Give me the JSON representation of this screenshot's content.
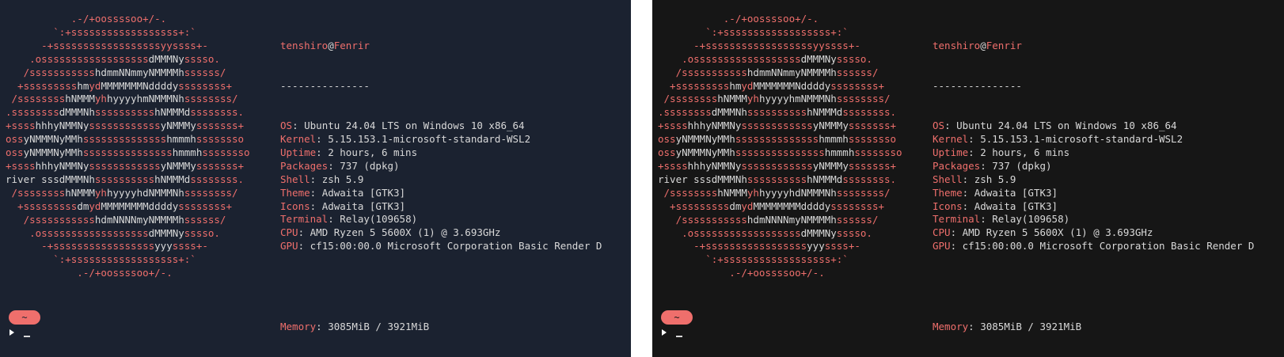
{
  "colors": {
    "left_bg": "#1b2230",
    "right_bg": "#161616",
    "accent": "#ef6f6c",
    "text": "#d9d9d9"
  },
  "ascii_logo": [
    [
      [
        "           .-/+oossssoo+/-.",
        "r"
      ]
    ],
    [
      [
        "        `:+ssssssssssssssssss+:`",
        "r"
      ]
    ],
    [
      [
        "      -+ssssssssssssssssssyyssss+-",
        "r"
      ]
    ],
    [
      [
        "    .ossssssssssssssssss",
        "r"
      ],
      [
        "dMMMNy",
        "w"
      ],
      [
        "sssso.",
        "r"
      ]
    ],
    [
      [
        "   /sssssssssss",
        "r"
      ],
      [
        "hdmmNNmmyNMMMMh",
        "w"
      ],
      [
        "ssssss/",
        "r"
      ]
    ],
    [
      [
        "  +sssssssss",
        "r"
      ],
      [
        "hm",
        "w"
      ],
      [
        "yd",
        "r"
      ],
      [
        "MMMMMMMNddddy",
        "w"
      ],
      [
        "ssssssss+",
        "r"
      ]
    ],
    [
      [
        " /ssssssss",
        "r"
      ],
      [
        "hNMMM",
        "w"
      ],
      [
        "yh",
        "r"
      ],
      [
        "hyyyyhmNMMMNh",
        "w"
      ],
      [
        "ssssssss/",
        "r"
      ]
    ],
    [
      [
        ".ssssssss",
        "r"
      ],
      [
        "dMMMNh",
        "w"
      ],
      [
        "ssssssssss",
        "r"
      ],
      [
        "hNMMMd",
        "w"
      ],
      [
        "ssssssss.",
        "r"
      ]
    ],
    [
      [
        "+ssss",
        "r"
      ],
      [
        "hhhyNMMNy",
        "w"
      ],
      [
        "ssssssssssss",
        "r"
      ],
      [
        "yNMMMy",
        "w"
      ],
      [
        "sssssss+",
        "r"
      ]
    ],
    [
      [
        "oss",
        "r"
      ],
      [
        "yNMMMNyMMh",
        "w"
      ],
      [
        "ssssssssssssss",
        "r"
      ],
      [
        "hmmmh",
        "w"
      ],
      [
        "ssssssso",
        "r"
      ]
    ],
    [
      [
        "oss",
        "r"
      ],
      [
        "yNMMMNyMMh",
        "w"
      ],
      [
        "sssssssssssssss",
        "r"
      ],
      [
        "hmmmh",
        "w"
      ],
      [
        "ssssssso",
        "r"
      ]
    ],
    [
      [
        "+ssss",
        "r"
      ],
      [
        "hhhyNMMNy",
        "w"
      ],
      [
        "ssssssssssss",
        "r"
      ],
      [
        "yNMMMy",
        "w"
      ],
      [
        "sssssss+",
        "r"
      ]
    ],
    [
      [
        "river sss",
        "w"
      ],
      [
        "dMMMNh",
        "w"
      ],
      [
        "ssssssssss",
        "r"
      ],
      [
        "hNMMMd",
        "w"
      ],
      [
        "ssssssss.",
        "r"
      ]
    ],
    [
      [
        " /ssssssss",
        "r"
      ],
      [
        "hNMMM",
        "w"
      ],
      [
        "yh",
        "r"
      ],
      [
        "hyyyyhdNMMMNh",
        "w"
      ],
      [
        "ssssssss/",
        "r"
      ]
    ],
    [
      [
        "  +sssssssss",
        "r"
      ],
      [
        "dm",
        "w"
      ],
      [
        "yd",
        "r"
      ],
      [
        "MMMMMMMMddddy",
        "w"
      ],
      [
        "ssssssss+",
        "r"
      ]
    ],
    [
      [
        "   /sssssssssss",
        "r"
      ],
      [
        "hdmNNNNmyNMMMMh",
        "w"
      ],
      [
        "ssssss/",
        "r"
      ]
    ],
    [
      [
        "    .ossssssssssssssssss",
        "r"
      ],
      [
        "dMMMNy",
        "w"
      ],
      [
        "sssso.",
        "r"
      ]
    ],
    [
      [
        "      -+sssssssssssssssss",
        "r"
      ],
      [
        "yyy",
        "w"
      ],
      [
        "ssss+-",
        "r"
      ]
    ],
    [
      [
        "        `:+ssssssssssssssssss+:`",
        "r"
      ]
    ],
    [
      [
        "            .-/+oossssoo+/-.",
        "r"
      ]
    ]
  ],
  "info": {
    "user": "tenshiro",
    "at": "@",
    "host": "Fenrir",
    "separator": "---------------",
    "rows": [
      {
        "key": "OS",
        "value": "Ubuntu 24.04 LTS on Windows 10 x86_64"
      },
      {
        "key": "Kernel",
        "value": "5.15.153.1-microsoft-standard-WSL2"
      },
      {
        "key": "Uptime",
        "value": "2 hours, 6 mins"
      },
      {
        "key": "Packages",
        "value": "737 (dpkg)"
      },
      {
        "key": "Shell",
        "value": "zsh 5.9"
      },
      {
        "key": "Theme",
        "value": "Adwaita [GTK3]"
      },
      {
        "key": "Icons",
        "value": "Adwaita [GTK3]"
      },
      {
        "key": "Terminal",
        "value": "Relay(109658)"
      },
      {
        "key": "CPU",
        "value": "AMD Ryzen 5 5600X (1) @ 3.693GHz"
      },
      {
        "key": "GPU",
        "value": "cf15:00:00.0 Microsoft Corporation Basic Render D"
      }
    ],
    "memory": {
      "key": "Memory",
      "value": "3085MiB / 3921MiB"
    }
  },
  "prompt": {
    "dir": "~",
    "cursor": "_"
  }
}
